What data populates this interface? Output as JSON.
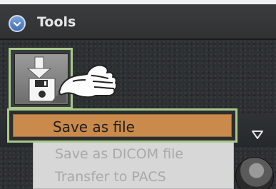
{
  "header": {
    "title": "Tools"
  },
  "menu": {
    "items": [
      {
        "label": "Save as file",
        "state": "highlighted"
      },
      {
        "label": "Save as DICOM file",
        "state": "disabled"
      },
      {
        "label": "Transfer to PACS",
        "state": "disabled"
      }
    ]
  },
  "colors": {
    "highlight_border": "#a9c98a",
    "menu_highlight": "#c98a4c",
    "menu_bg": "#d7d7d7",
    "disabled_text": "#a9a9a9",
    "header_text": "#e6e6e6",
    "chevron_blue": "#4a7cc1"
  },
  "icons": {
    "collapse": "chevron-down-circle-icon",
    "save": "save-floppy-download-icon",
    "cursor": "hand-pointer-icon",
    "dropdown": "triangle-down-icon"
  }
}
